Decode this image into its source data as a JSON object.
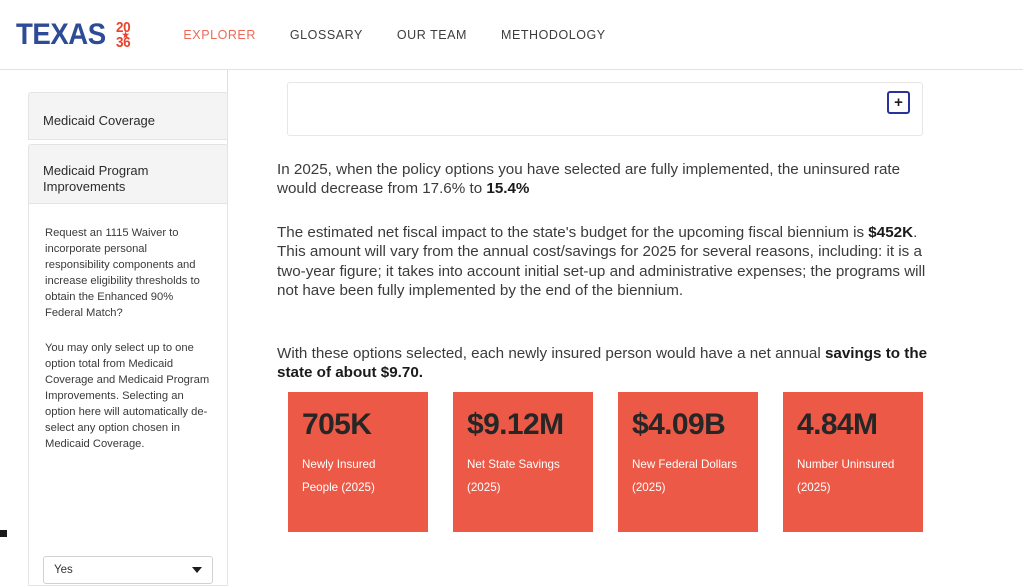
{
  "header": {
    "logo": {
      "wordmark": "TEXAS",
      "year_top": "20",
      "year_bottom": "36",
      "star": "★",
      "blue": "#2e4b96",
      "red": "#e8432e"
    },
    "nav": [
      {
        "label": "EXPLORER",
        "active": true
      },
      {
        "label": "GLOSSARY",
        "active": false
      },
      {
        "label": "OUR TEAM",
        "active": false
      },
      {
        "label": "METHODOLOGY",
        "active": false
      }
    ]
  },
  "sidebar": {
    "tabs": [
      {
        "label": "Medicaid Coverage"
      },
      {
        "label": "Medicaid Program Improvements"
      }
    ],
    "question": "Request an 1115 Waiver to incorporate personal responsibility components and increase eligibility thresholds to obtain the Enhanced 90% Federal Match?",
    "note": "You may only select up to one option total from Medicaid Coverage and Medicaid Program Improvements. Selecting an option here will automatically de-select any option chosen in Medicaid Coverage.",
    "select": {
      "value": "Yes",
      "caret_icon": "chevron-down-icon"
    }
  },
  "main": {
    "options_bar": {
      "add_button_label": "+"
    },
    "paragraphs": {
      "uninsured_rate": {
        "prefix": "In 2025, when the policy options you have selected are fully implemented, the uninsured rate would decrease from 17.6% to ",
        "emphasis": "15.4%",
        "suffix": ""
      },
      "fiscal_impact": {
        "prefix": "The estimated net fiscal impact to the state's budget for the upcoming fiscal biennium is ",
        "emphasis": "$452K",
        "suffix": ". This amount will vary from the annual cost/savings for 2025 for several reasons, including: it is a two-year figure; it takes into account initial set-up and administrative expenses; the programs will not have been fully implemented by the end of the biennium."
      },
      "per_person": {
        "prefix": "With these options selected, each newly insured person would have a net annual ",
        "emphasis": "savings to the state of about $9.70.",
        "suffix": ""
      }
    },
    "stat_cards": [
      {
        "value": "705K",
        "label": "Newly Insured People (2025)"
      },
      {
        "value": "$9.12M",
        "label": "Net State Savings (2025)"
      },
      {
        "value": "$4.09B",
        "label": "New Federal Dollars (2025)"
      },
      {
        "value": "4.84M",
        "label": "Number Uninsured (2025)"
      }
    ],
    "card_color": "#ec5a47"
  }
}
